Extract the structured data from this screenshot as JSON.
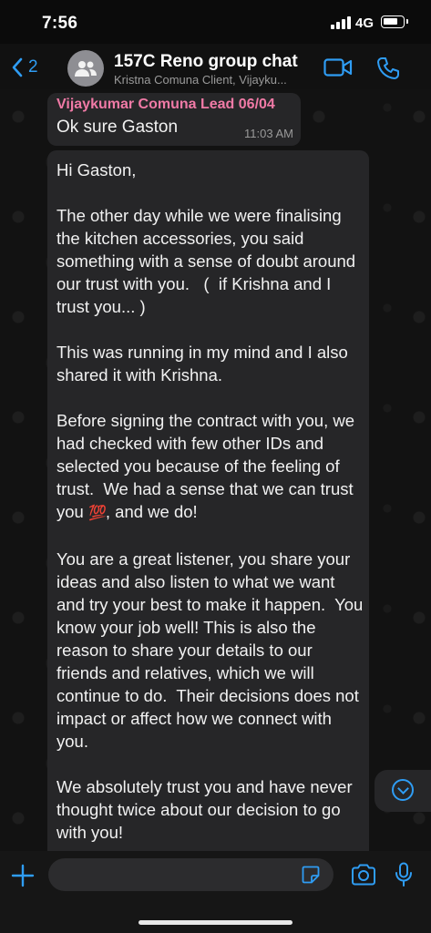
{
  "status_bar": {
    "time": "7:56",
    "network": "4G"
  },
  "header": {
    "back_count": "2",
    "title": "157C Reno group chat",
    "subtitle": "Kristna Comuna Client, Vijayku..."
  },
  "messages": [
    {
      "sender": "Vijaykumar Comuna Lead 06/04",
      "text": "Ok sure Gaston",
      "time": "11:03 AM"
    },
    {
      "text_before_emoji": "Hi Gaston,\n\nThe other day while we were finalising the kitchen accessories, you said something with a sense of doubt around our trust with you.   (  if Krishna and I trust you... )\n\nThis was running in my mind and I also shared it with Krishna.\n\nBefore signing the contract with you, we had checked with few other IDs and selected you because of the feeling of trust.  We had a sense that we can trust you ",
      "emoji": "💯",
      "text_after_emoji": ", and we do!\n\nYou are a great listener, you share your ideas and also listen to what we want and try your best to make it happen.  You know your job well! This is also the reason to share your details to our friends and relatives, which we will continue to do.  Their decisions does not impact or affect how we connect with you.\n\nWe absolutely trust you and have never thought twice about our decision to go with you!"
    }
  ],
  "composer": {
    "placeholder": ""
  },
  "colors": {
    "accent": "#2f9df4",
    "sender_name": "#f07aa6",
    "bubble": "#262628",
    "background": "#121212"
  },
  "icons": [
    "back-chevron-icon",
    "group-avatar-icon",
    "video-call-icon",
    "phone-icon",
    "chevron-down-icon",
    "plus-icon",
    "sticker-icon",
    "camera-icon",
    "microphone-icon"
  ]
}
